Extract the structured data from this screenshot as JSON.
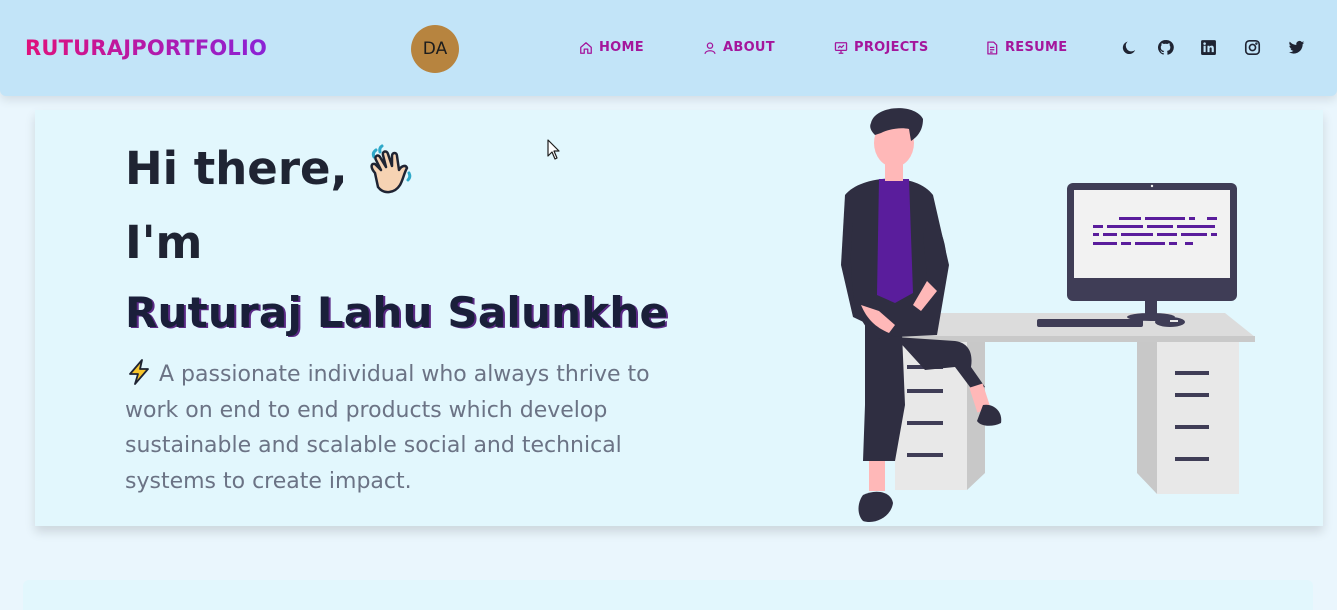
{
  "navbar": {
    "brand": "RUTURAJPORTFOLIO",
    "avatar_initials": "DA",
    "links": [
      {
        "label": "HOME",
        "icon": "home-icon"
      },
      {
        "label": "ABOUT",
        "icon": "user-icon"
      },
      {
        "label": "PROJECTS",
        "icon": "presentation-icon"
      },
      {
        "label": "RESUME",
        "icon": "document-icon"
      }
    ],
    "icons": [
      "moon-icon",
      "github-icon",
      "linkedin-icon",
      "instagram-icon",
      "twitter-icon"
    ]
  },
  "hero": {
    "greeting": "Hi there,",
    "greeting_emoji": "waving-hand-icon",
    "intro": "I'm",
    "name": "Ruturaj Lahu Salunkhe",
    "bio": "A passionate individual who always thrive to work on end to end products which develop sustainable and scalable social and technical systems to create impact.",
    "bio_icon": "lightning-icon"
  },
  "colors": {
    "navbar_bg": "#c2e4f8",
    "brand_gradient_start": "#e0117b",
    "brand_gradient_end": "#8a22d6",
    "nav_link": "#a4169c",
    "hero_bg": "#e2f7fd",
    "page_bg": "#eaf6fd"
  }
}
